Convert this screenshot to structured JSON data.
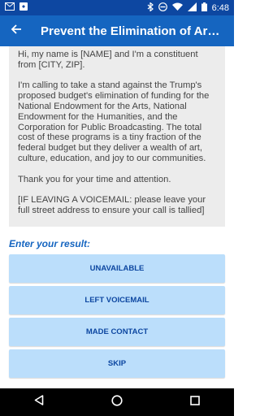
{
  "status_bar": {
    "time": "6:48",
    "icons": [
      "email-icon",
      "notification-icon",
      "bluetooth-icon",
      "dnd-icon",
      "wifi-icon",
      "signal-icon",
      "battery-icon"
    ],
    "background": "#0d47a1"
  },
  "app_bar": {
    "title": "Prevent the Elimination of Arts a...",
    "background": "#1565c0"
  },
  "script": {
    "paragraphs": [
      "Hi, my name is [NAME] and I'm a constituent from [CITY, ZIP].",
      "I'm calling to take a stand against the Trump's proposed budget's elimination of funding for the National Endowment for the Arts, National Endowment for the Humanities, and the Corporation for Public Broadcasting. The total cost of these programs is a tiny fraction of the federal budget but they deliver a wealth of art, culture, education, and joy to our communities.",
      "Thank you for your time and attention.",
      "[IF LEAVING A VOICEMAIL: please leave your full street address to ensure your call is tallied]"
    ]
  },
  "result": {
    "label": "Enter your result:",
    "buttons": [
      "UNAVAILABLE",
      "LEFT VOICEMAIL",
      "MADE CONTACT",
      "SKIP"
    ]
  },
  "colors": {
    "accent": "#1565c0",
    "button_bg": "#bbdefb",
    "script_bg": "#ececec"
  },
  "nav_bar": {
    "icons": [
      "back-triangle-icon",
      "home-circle-icon",
      "recents-square-icon"
    ]
  }
}
